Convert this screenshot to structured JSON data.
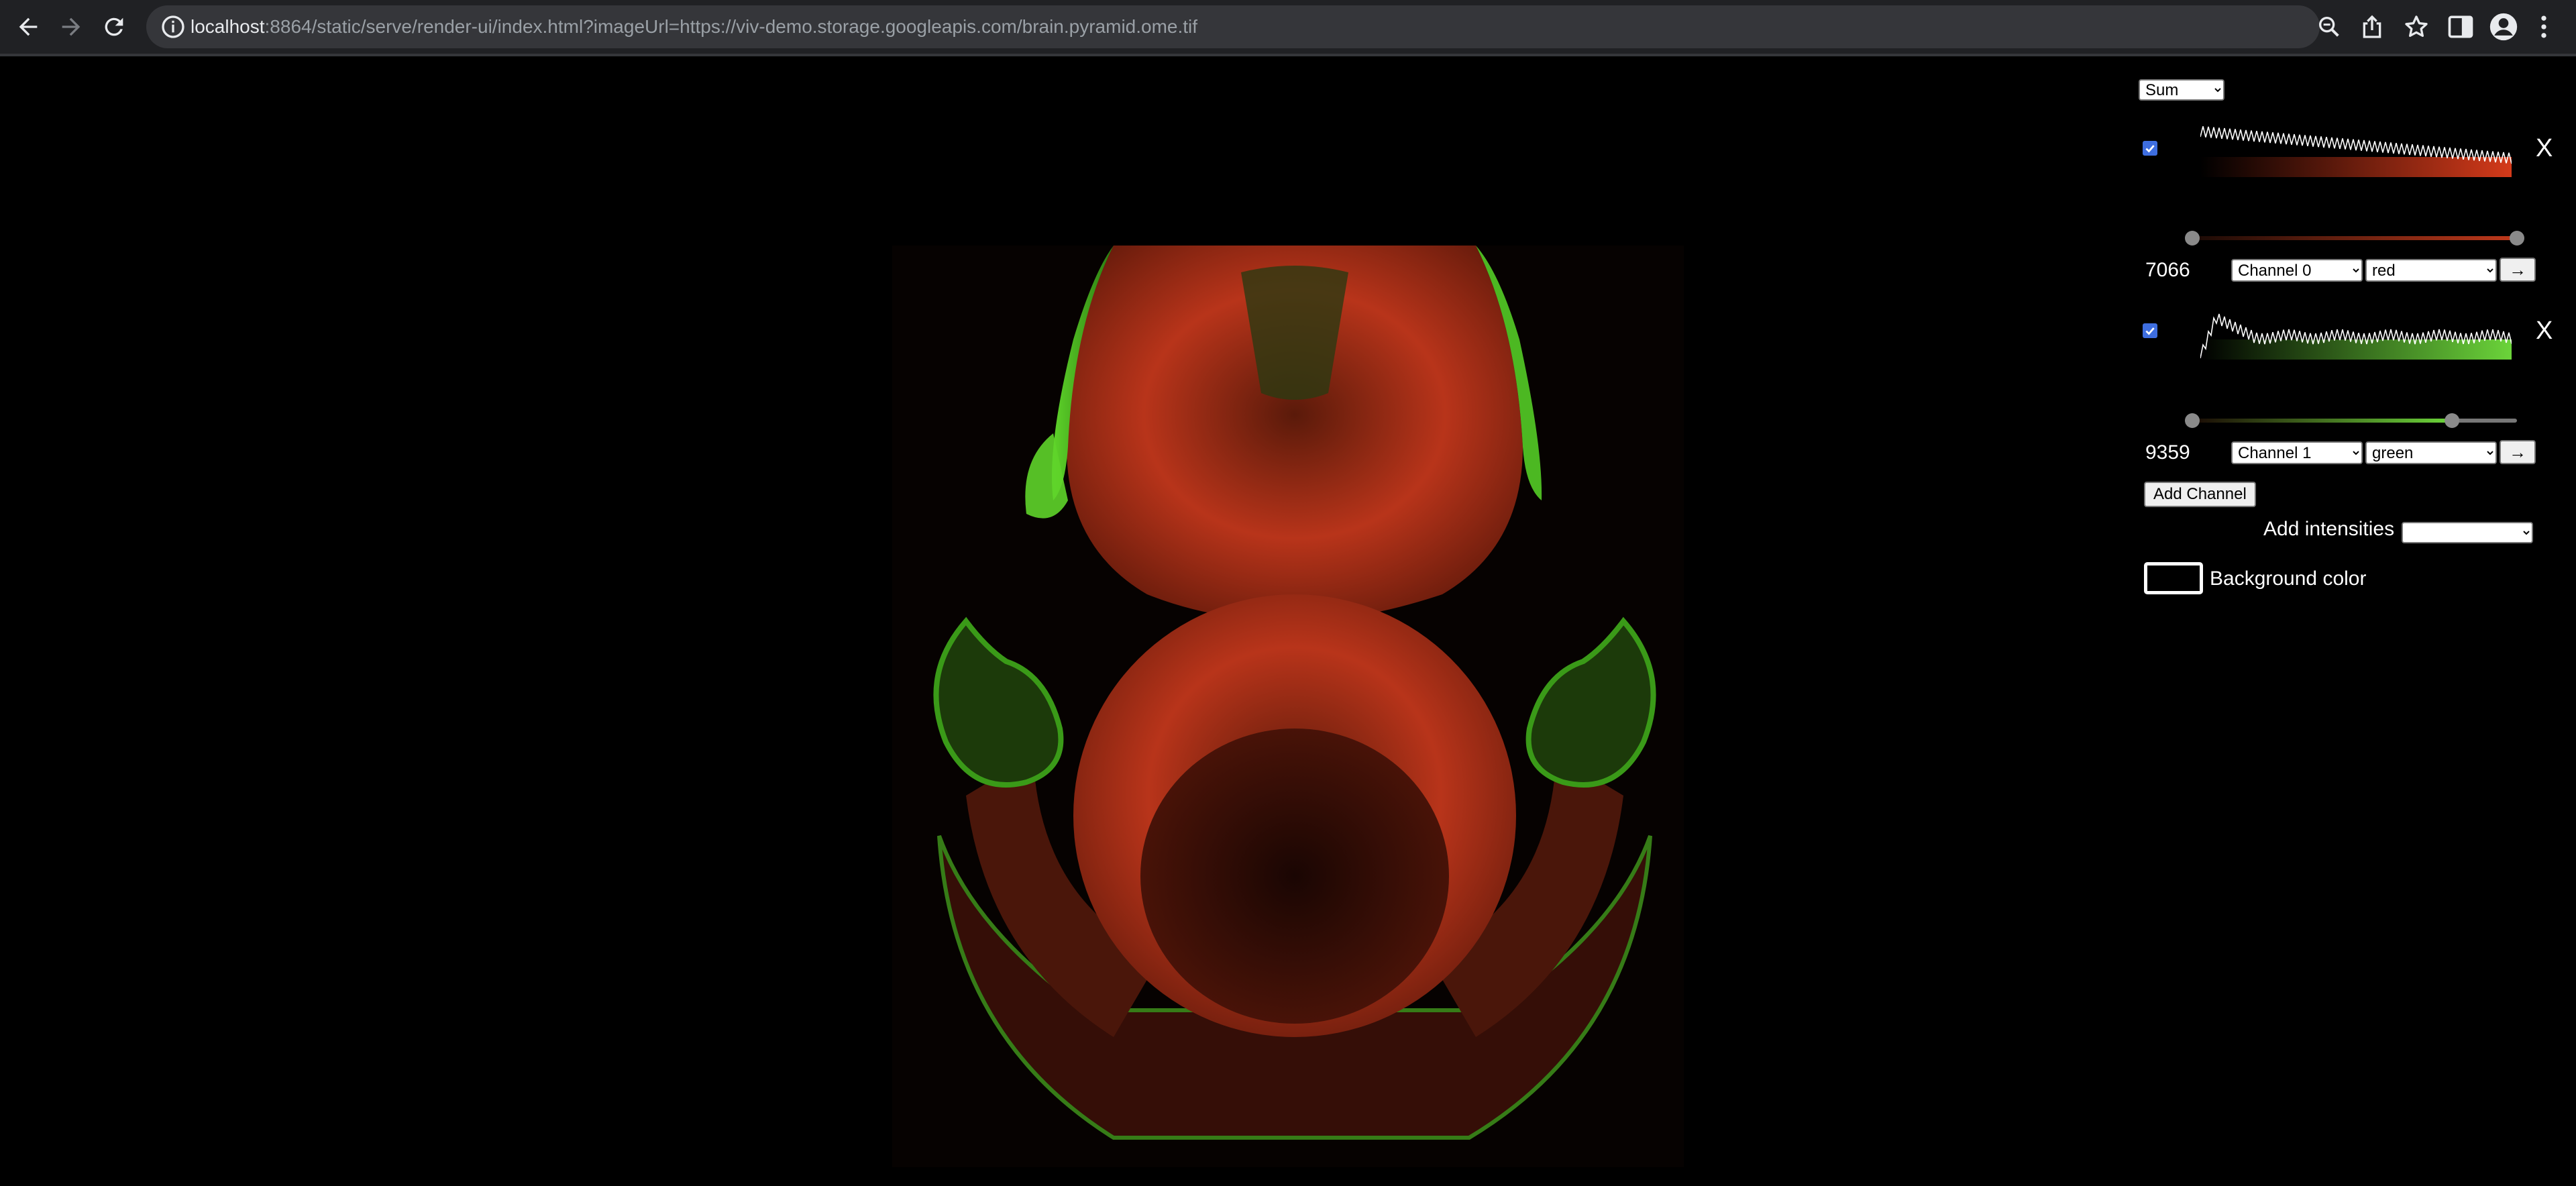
{
  "browser": {
    "url_host": "localhost",
    "url_rest": ":8864/static/serve/render-ui/index.html?imageUrl=https://viv-demo.storage.googleapis.com/brain.pyramid.ome.tif",
    "icons": [
      "back-icon",
      "forward-icon",
      "reload-icon",
      "info-icon",
      "zoom-icon",
      "share-icon",
      "bookmark-star-icon",
      "side-panel-icon",
      "profile-icon",
      "menu-icon"
    ]
  },
  "viewer": {
    "image": "fluorescence microscopy of brain tissue, red and green channels",
    "background_color": "#000000"
  },
  "controls": {
    "projection": {
      "selected": "Sum"
    },
    "channels": [
      {
        "enabled": true,
        "histogram_color": "#d43a1a",
        "slider_color": "#c0391b",
        "slider_low": 0.0,
        "slider_high": 1.0,
        "limit_value": "7066",
        "channel_select": "Channel 0",
        "color_select": "red",
        "remove_label": "X",
        "arrow_label": "→"
      },
      {
        "enabled": true,
        "histogram_color": "#6bd43a",
        "slider_color": "#6bd43a",
        "slider_low": 0.0,
        "slider_high": 0.8,
        "limit_value": "9359",
        "channel_select": "Channel 1",
        "color_select": "green",
        "remove_label": "X",
        "arrow_label": "→"
      }
    ],
    "add_channel_label": "Add Channel",
    "add_intensities_label": "Add intensities",
    "add_intensities_selected": "",
    "background_color_label": "Background color",
    "background_color_value": "#000000"
  }
}
